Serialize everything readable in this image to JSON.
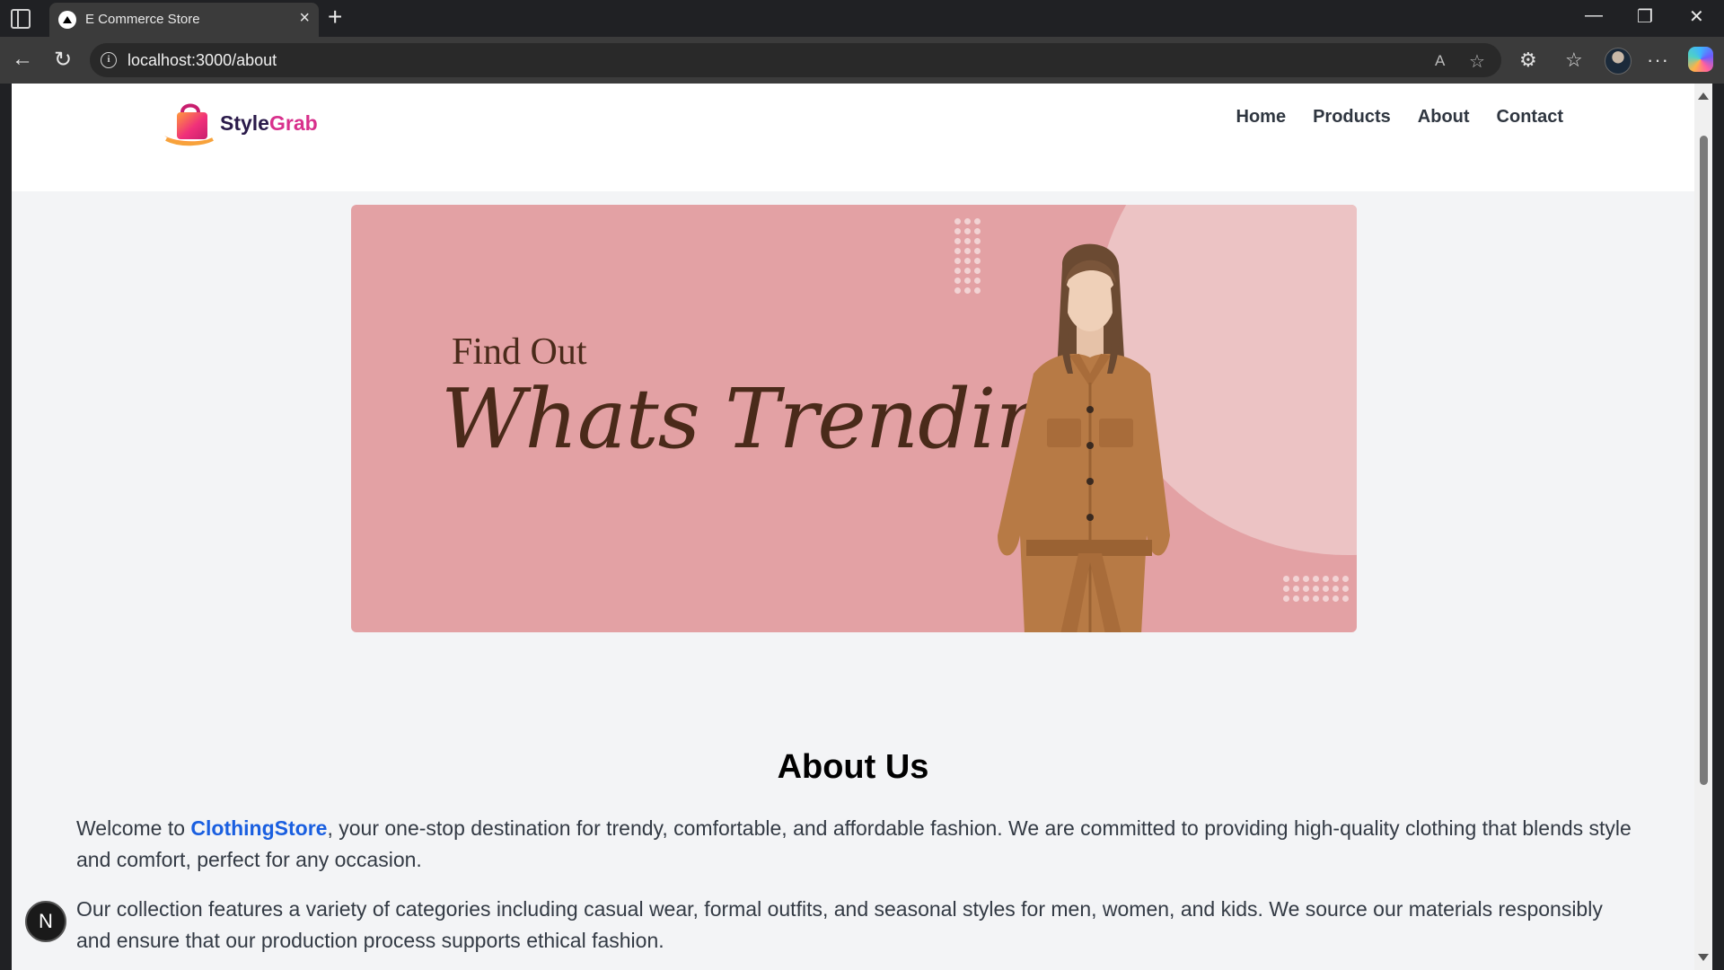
{
  "browser": {
    "tab_title": "E Commerce Store",
    "url": "localhost:3000/about"
  },
  "site": {
    "logo": {
      "part1": "Style",
      "part2": "Grab"
    },
    "nav": [
      {
        "label": "Home"
      },
      {
        "label": "Products"
      },
      {
        "label": "About"
      },
      {
        "label": "Contact"
      }
    ]
  },
  "banner": {
    "line1": "Find Out",
    "line2": "Whats Trending"
  },
  "about": {
    "title": "About Us",
    "para1_prefix": "Welcome to ",
    "para1_brand": "ClothingStore",
    "para1_rest": ", your one-stop destination for trendy, comfortable, and affordable fashion. We are committed to providing high-quality clothing that blends style and comfort, perfect for any occasion.",
    "para2": "Our collection features a variety of categories including casual wear, formal outfits, and seasonal styles for men, women, and kids. We source our materials responsibly and ensure that our production process supports ethical fashion."
  },
  "dev_badge": "N",
  "colors": {
    "brand_link": "#1a5fe0",
    "banner_bg": "#e3a1a4",
    "logo_accent": "#d8308c"
  }
}
